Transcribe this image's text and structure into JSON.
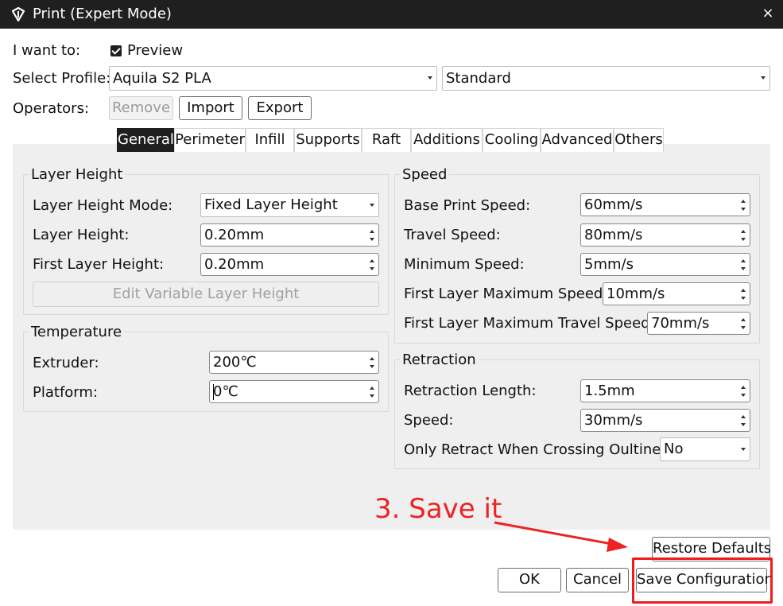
{
  "window": {
    "title": "Print (Expert Mode)",
    "close_icon": "×"
  },
  "top": {
    "want_label": "I want to:",
    "preview_label": "Preview",
    "preview_checked": true,
    "profile_label": "Select Profile:",
    "profile_value": "Aquila S2 PLA",
    "quality_value": "Standard",
    "operators_label": "Operators:",
    "remove_label": "Remove",
    "import_label": "Import",
    "export_label": "Export"
  },
  "tabs": [
    {
      "label": "General",
      "active": true
    },
    {
      "label": "Perimeter"
    },
    {
      "label": "Infill"
    },
    {
      "label": "Supports"
    },
    {
      "label": "Raft"
    },
    {
      "label": "Additions"
    },
    {
      "label": "Cooling"
    },
    {
      "label": "Advanced"
    },
    {
      "label": "Others"
    }
  ],
  "layer_height": {
    "title": "Layer Height",
    "mode_label": "Layer Height Mode:",
    "mode_value": "Fixed Layer Height",
    "height_label": "Layer Height:",
    "height_value": "0.20mm",
    "first_label": "First Layer Height:",
    "first_value": "0.20mm",
    "edit_variable_label": "Edit Variable Layer Height"
  },
  "temperature": {
    "title": "Temperature",
    "extruder_label": "Extruder:",
    "extruder_value": "200℃",
    "platform_label": "Platform:",
    "platform_value": "0℃"
  },
  "speed": {
    "title": "Speed",
    "base_label": "Base Print Speed:",
    "base_value": "60mm/s",
    "travel_label": "Travel Speed:",
    "travel_value": "80mm/s",
    "min_label": "Minimum Speed:",
    "min_value": "5mm/s",
    "first_max_label": "First Layer Maximum Speed:",
    "first_max_value": "10mm/s",
    "first_travel_label": "First Layer Maximum Travel Speed:",
    "first_travel_value": "70mm/s"
  },
  "retraction": {
    "title": "Retraction",
    "length_label": "Retraction Length:",
    "length_value": "1.5mm",
    "speed_label": "Speed:",
    "speed_value": "30mm/s",
    "only_label": "Only Retract When Crossing Oultine:",
    "only_value": "No"
  },
  "bottom": {
    "restore_label": "Restore Defaults",
    "ok_label": "OK",
    "cancel_label": "Cancel",
    "save_label": "Save Configuration"
  },
  "annotation": {
    "text": "3. Save it",
    "color": "#ee2222"
  }
}
